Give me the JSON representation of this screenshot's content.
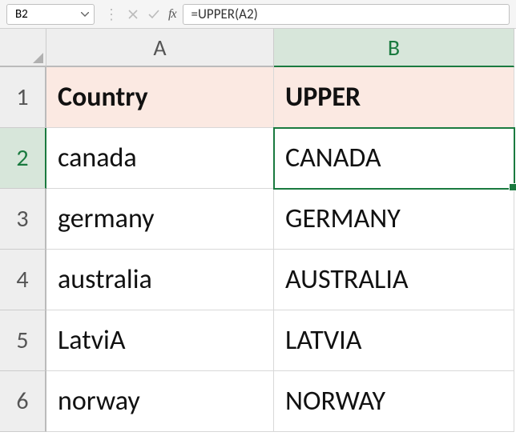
{
  "formula_bar": {
    "cell_ref": "B2",
    "formula": "=UPPER(A2)",
    "fx_label": "fx"
  },
  "columns": [
    "A",
    "B"
  ],
  "selected_cell": "B2",
  "headers": {
    "A": "Country",
    "B": "UPPER"
  },
  "rows": [
    {
      "n": "1"
    },
    {
      "n": "2",
      "A": "canada",
      "B": "CANADA"
    },
    {
      "n": "3",
      "A": "germany",
      "B": "GERMANY"
    },
    {
      "n": "4",
      "A": "australia",
      "B": "AUSTRALIA"
    },
    {
      "n": "5",
      "A": "LatviA",
      "B": "LATVIA"
    },
    {
      "n": "6",
      "A": "norway",
      "B": "NORWAY"
    }
  ]
}
